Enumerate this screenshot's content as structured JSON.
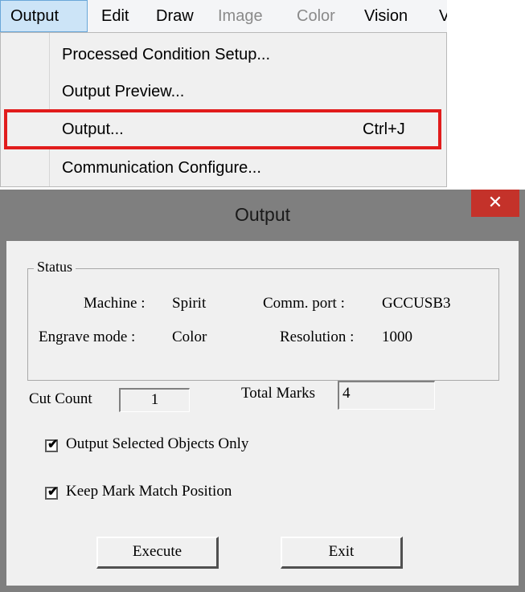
{
  "menubar": {
    "items": [
      {
        "label": "Output",
        "state": "active"
      },
      {
        "label": "Edit",
        "state": "enabled"
      },
      {
        "label": "Draw",
        "state": "enabled"
      },
      {
        "label": "Image",
        "state": "disabled"
      },
      {
        "label": "Color",
        "state": "disabled"
      },
      {
        "label": "Vision",
        "state": "enabled"
      },
      {
        "label": "V",
        "state": "enabled"
      }
    ]
  },
  "dropdown": {
    "items": [
      {
        "label": "Processed Condition Setup...",
        "shortcut": ""
      },
      {
        "label": "Output Preview...",
        "shortcut": ""
      },
      {
        "label": "Output...",
        "shortcut": "Ctrl+J",
        "highlighted": true
      },
      {
        "label": "Communication Configure...",
        "shortcut": ""
      }
    ],
    "highlight_color": "#e11c1c"
  },
  "dialog": {
    "title": "Output",
    "close_glyph": "✕",
    "close_color": "#c4322a",
    "status": {
      "legend": "Status",
      "machine_label": "Machine :",
      "machine_value": "Spirit",
      "comm_label": "Comm. port :",
      "comm_value": "GCCUSB3",
      "engrave_label": "Engrave mode :",
      "engrave_value": "Color",
      "resolution_label": "Resolution :",
      "resolution_value": "1000"
    },
    "cut_count_label": "Cut Count",
    "cut_count_value": "1",
    "total_marks_label": "Total Marks",
    "total_marks_value": "4",
    "options": [
      {
        "label": "Output Selected Objects Only",
        "checked": true
      },
      {
        "label": "Keep Mark Match Position",
        "checked": true
      }
    ],
    "execute_label": "Execute",
    "exit_label": "Exit"
  }
}
